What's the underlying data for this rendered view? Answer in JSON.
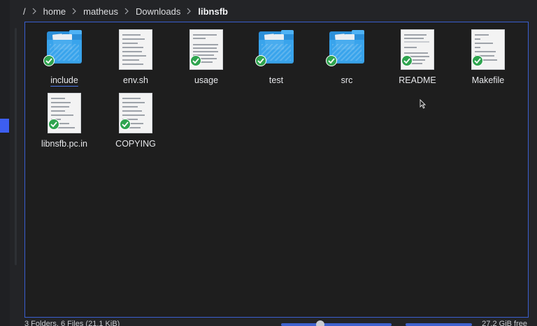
{
  "breadcrumb": {
    "root": "/",
    "parts": [
      "home",
      "matheus",
      "Downloads"
    ],
    "current": "libnsfb"
  },
  "items": [
    {
      "label": "include",
      "kind": "folder",
      "icon": "folder-icon",
      "synced": true
    },
    {
      "label": "env.sh",
      "kind": "file",
      "icon": "text-file-icon",
      "synced": false
    },
    {
      "label": "usage",
      "kind": "file",
      "icon": "text-file-icon",
      "synced": true
    },
    {
      "label": "test",
      "kind": "folder",
      "icon": "folder-icon",
      "synced": true
    },
    {
      "label": "src",
      "kind": "folder",
      "icon": "folder-icon",
      "synced": true
    },
    {
      "label": "README",
      "kind": "file",
      "icon": "text-file-icon",
      "synced": true
    },
    {
      "label": "Makefile",
      "kind": "file",
      "icon": "text-file-icon",
      "synced": true
    },
    {
      "label": "libnsfb.pc.in",
      "kind": "file",
      "icon": "text-file-icon",
      "synced": true
    },
    {
      "label": "COPYING",
      "kind": "file",
      "icon": "text-file-icon",
      "synced": true
    }
  ],
  "status": {
    "summary": "3 Folders, 6 Files (21.1 KiB)",
    "free_space": "27.2 GiB free"
  },
  "colors": {
    "accent": "#3d5ef0",
    "folder": "#2b8fd9",
    "sync_ok": "#2fa44f",
    "background": "#1e1e1e"
  }
}
